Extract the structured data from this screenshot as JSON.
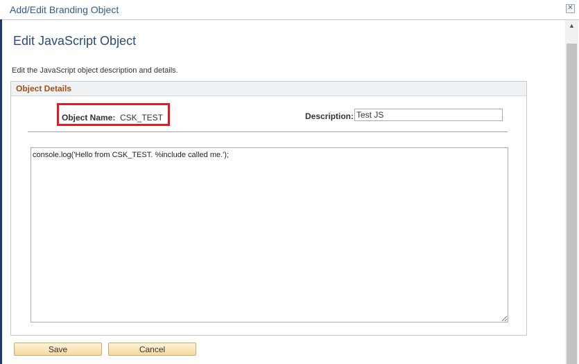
{
  "window": {
    "title": "Add/Edit Branding Object",
    "close_glyph": "✕"
  },
  "page": {
    "title": "Edit JavaScript Object",
    "instructions": "Edit the JavaScript object description and details."
  },
  "group": {
    "title": "Object Details"
  },
  "object": {
    "name_label": "Object Name:",
    "name_value": "CSK_TEST",
    "description_label": "Description:",
    "description_value": "Test JS",
    "script": "console.log('Hello from CSK_TEST. %include called me.');"
  },
  "buttons": {
    "save": "Save",
    "cancel": "Cancel"
  },
  "scrollbar": {
    "up_glyph": "▲",
    "down_glyph": "▼"
  },
  "colors": {
    "title_blue": "#2a4b7c",
    "group_title_brown": "#a14f12",
    "highlight_red": "#e01b24",
    "button_fill": "#f7d9a2"
  }
}
